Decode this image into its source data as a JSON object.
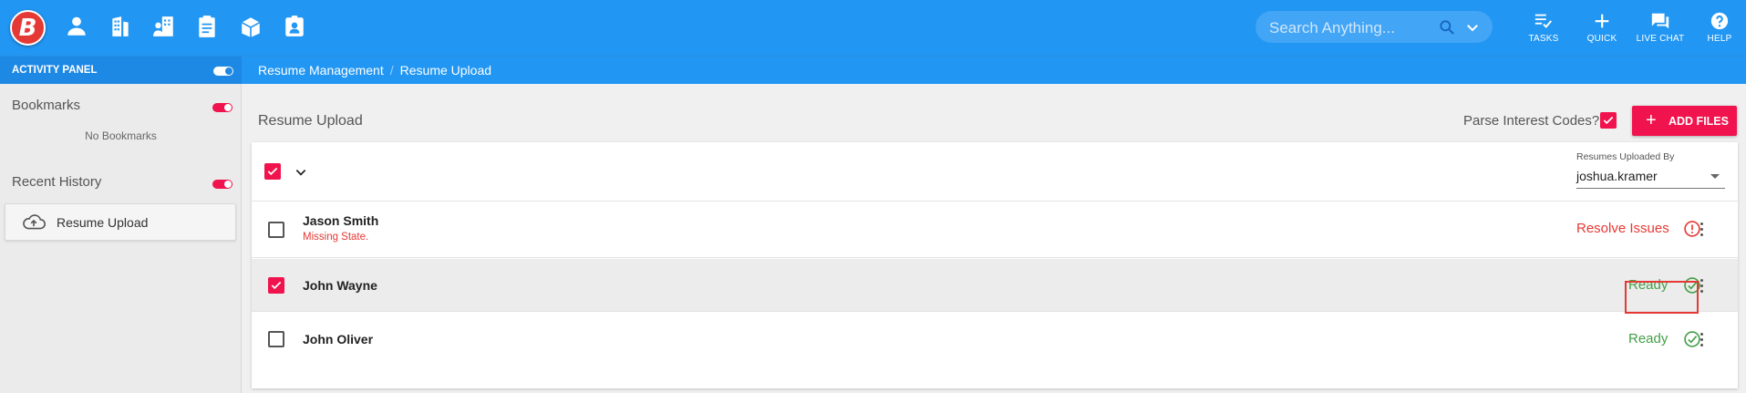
{
  "brand": {
    "logo_letter": "B",
    "accent": "#2196f3",
    "danger": "#f0134d",
    "success": "#43a047"
  },
  "nav_icons": [
    "person-icon",
    "building-icon",
    "company-icon",
    "clipboard-icon",
    "box-icon",
    "badge-icon"
  ],
  "search": {
    "placeholder": "Search Anything..."
  },
  "actions": {
    "tasks": "TASKS",
    "quick": "QUICK",
    "live_chat": "LIVE CHAT",
    "help": "HELP"
  },
  "sidebar": {
    "panel_title": "ACTIVITY PANEL",
    "bookmarks": {
      "title": "Bookmarks",
      "empty": "No Bookmarks"
    },
    "recent_history": {
      "title": "Recent History",
      "items": [
        {
          "label": "Resume Upload",
          "icon": "cloud-upload-icon"
        }
      ]
    }
  },
  "breadcrumb": {
    "parent": "Resume Management",
    "separator": "/",
    "current": "Resume Upload"
  },
  "main": {
    "title": "Resume Upload",
    "parse_label": "Parse Interest Codes?",
    "parse_checked": true,
    "add_files_label": "ADD FILES",
    "uploaded_by": {
      "label": "Resumes Uploaded By",
      "value": "joshua.kramer"
    }
  },
  "resumes": [
    {
      "name": "Jason Smith",
      "error": "Missing State.",
      "status": "Resolve Issues",
      "status_type": "error",
      "checked": false
    },
    {
      "name": "John Wayne",
      "error": "",
      "status": "Ready",
      "status_type": "ready",
      "checked": true
    },
    {
      "name": "John Oliver",
      "error": "",
      "status": "Ready",
      "status_type": "ready",
      "checked": false
    }
  ]
}
